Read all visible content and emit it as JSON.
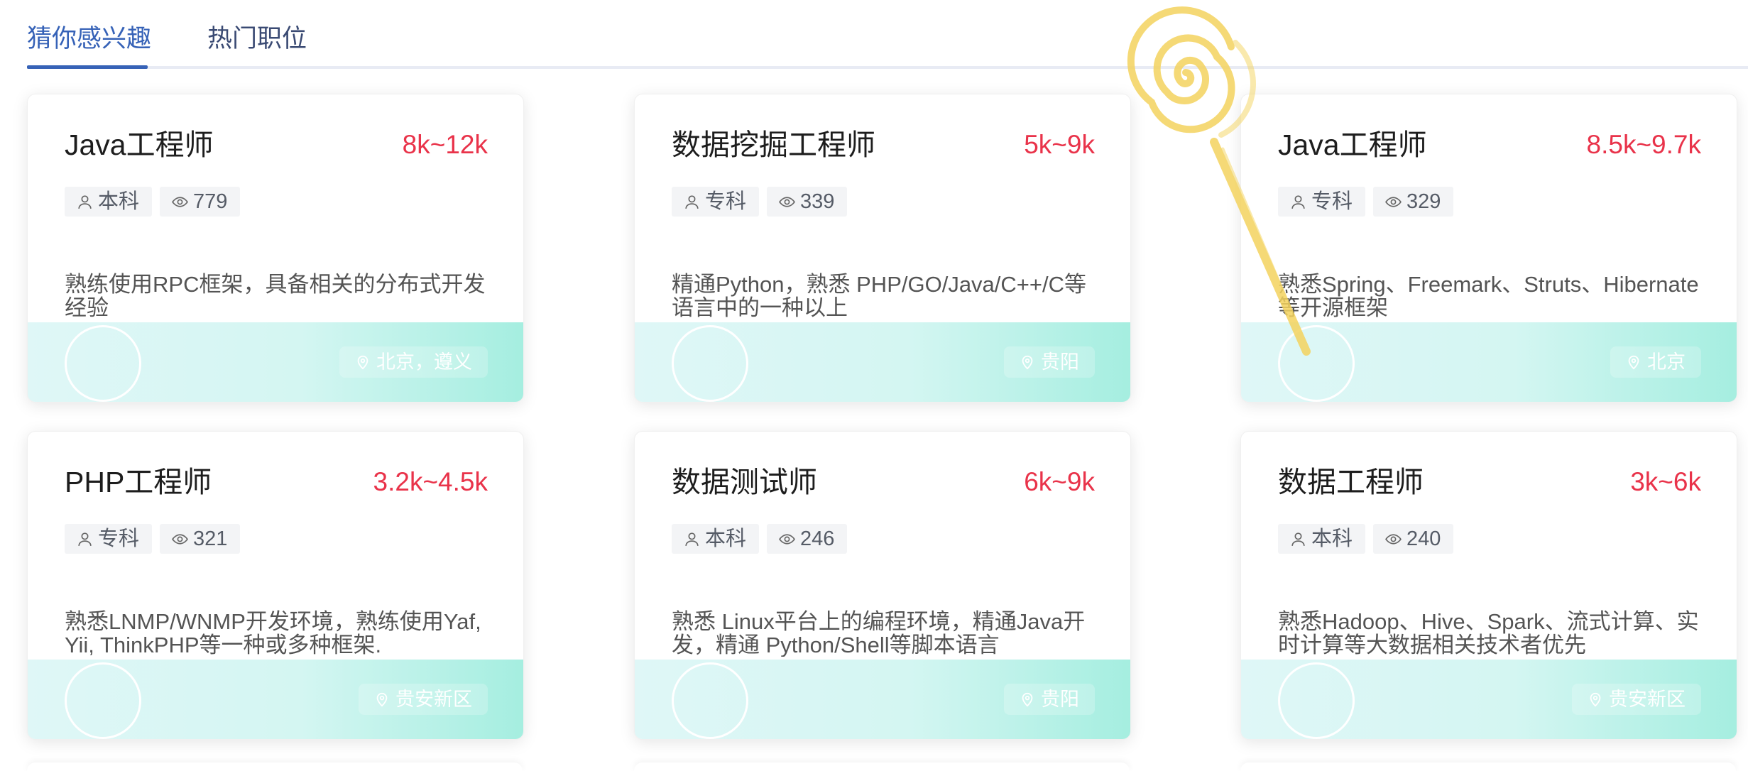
{
  "tabs": [
    {
      "label": "猜你感兴趣",
      "active": true
    },
    {
      "label": "热门职位",
      "active": false
    }
  ],
  "jobs": [
    {
      "title": "Java工程师",
      "salary": "8k~12k",
      "education": "本科",
      "views": "779",
      "description": "熟练使用RPC框架，具备相关的分布式开发经验",
      "location": "北京，遵义"
    },
    {
      "title": "数据挖掘工程师",
      "salary": "5k~9k",
      "education": "专科",
      "views": "339",
      "description": "精通Python，熟悉 PHP/GO/Java/C++/C等语言中的一种以上",
      "location": "贵阳"
    },
    {
      "title": "Java工程师",
      "salary": "8.5k~9.7k",
      "education": "专科",
      "views": "329",
      "description": "熟悉Spring、Freemark、Struts、Hibernate 等开源框架",
      "location": "北京"
    },
    {
      "title": "PHP工程师",
      "salary": "3.2k~4.5k",
      "education": "专科",
      "views": "321",
      "description": "熟悉LNMP/WNMP开发环境，熟练使用Yaf, Yii, ThinkPHP等一种或多种框架.",
      "location": "贵安新区"
    },
    {
      "title": "数据测试师",
      "salary": "6k~9k",
      "education": "本科",
      "views": "246",
      "description": "熟悉 Linux平台上的编程环境，精通Java开发，精通 Python/Shell等脚本语言",
      "location": "贵阳"
    },
    {
      "title": "数据工程师",
      "salary": "3k~6k",
      "education": "本科",
      "views": "240",
      "description": "熟悉Hadoop、Hive、Spark、流式计算、实时计算等大数据相关技术者优先",
      "location": "贵安新区"
    }
  ],
  "icons": {
    "education": "user-icon",
    "views": "eye-icon",
    "location": "map-pin-icon"
  },
  "colors": {
    "accent": "#3662b7",
    "salary": "#e9334a",
    "footer_gradient_end": "#a5eee0"
  }
}
